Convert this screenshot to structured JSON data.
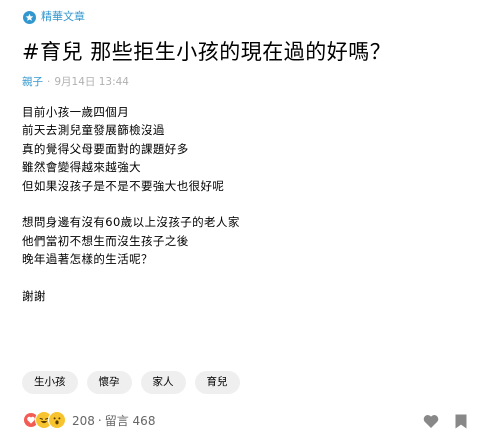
{
  "featured": {
    "label": "精華文章"
  },
  "post": {
    "title": "#育兒 那些拒生小孩的現在過的好嗎？",
    "board": "親子",
    "date": "9月14日 13:44",
    "lines": [
      "目前小孩一歲四個月",
      "前天去測兒童發展篩檢沒過",
      "真的覺得父母要面對的課題好多",
      "雖然會變得越來越強大",
      "但如果沒孩子是不是不要強大也很好呢",
      "",
      "想問身邊有沒有60歲以上沒孩子的老人家",
      "他們當初不想生而沒生孩子之後",
      "晚年過著怎樣的生活呢？",
      "",
      "謝謝"
    ],
    "tags": [
      "生小孩",
      "懷孕",
      "家人",
      "育兒"
    ]
  },
  "footer": {
    "reaction_count": "208",
    "separator": "‧",
    "comments": "留言 468"
  },
  "icons": {
    "featured": "star-badge-icon",
    "reactions": [
      "heart-icon",
      "laugh-icon",
      "wow-icon"
    ],
    "like": "heart-outline-icon",
    "bookmark": "bookmark-icon"
  },
  "colors": {
    "accent": "#3397cf",
    "tag_bg": "#efefef",
    "action_icon": "#888888"
  }
}
